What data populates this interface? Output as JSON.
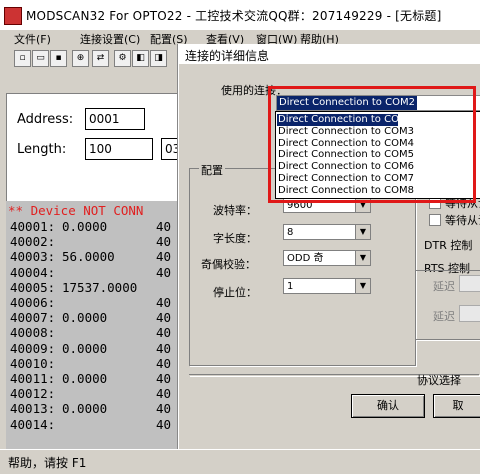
{
  "app": {
    "title": "MODSCAN32 For OPTO22 - 工控技术交流QQ群：207149229 - [无标题]",
    "menus": [
      "文件(F)",
      "连接设置(C)",
      "配置(S)",
      "查看(V)",
      "窗口(W)",
      "帮助(H)"
    ],
    "toolbar_icons": [
      "new-file-icon",
      "open-folder-icon",
      "save-icon",
      "print-icon",
      "connect-icon",
      "disconnect-icon",
      "tool-icon",
      "tool2-icon",
      "tool3-icon",
      "tool4-icon"
    ]
  },
  "form": {
    "address_label": "Address:",
    "address_value": "0001",
    "length_label": "Length:",
    "length_value": "100",
    "extra_value": "03"
  },
  "registers": {
    "error_text": "** Device NOT CONN",
    "rows": [
      {
        "addr": "40001:",
        "val": "0.0000",
        "tail": "40"
      },
      {
        "addr": "40002:",
        "val": "",
        "tail": "40"
      },
      {
        "addr": "40003:",
        "val": "56.0000",
        "tail": "40"
      },
      {
        "addr": "40004:",
        "val": "",
        "tail": "40"
      },
      {
        "addr": "40005:",
        "val": "17537.0000",
        "tail": ""
      },
      {
        "addr": "40006:",
        "val": "",
        "tail": "40"
      },
      {
        "addr": "40007:",
        "val": "0.0000",
        "tail": "40"
      },
      {
        "addr": "40008:",
        "val": "",
        "tail": "40"
      },
      {
        "addr": "40009:",
        "val": "0.0000",
        "tail": "40"
      },
      {
        "addr": "40010:",
        "val": "",
        "tail": "40"
      },
      {
        "addr": "40011:",
        "val": "0.0000",
        "tail": "40"
      },
      {
        "addr": "40012:",
        "val": "",
        "tail": "40"
      },
      {
        "addr": "40013:",
        "val": "0.0000",
        "tail": "40"
      },
      {
        "addr": "40014:",
        "val": "",
        "tail": "40"
      }
    ]
  },
  "status": {
    "text": "帮助，请按 F1"
  },
  "dialog": {
    "title": "连接的详细信息",
    "connection_label": "使用的连接：",
    "selected_connection": "Direct Connection to COM2",
    "options": [
      "Direct Connection to COM2",
      "Direct Connection to COM3",
      "Direct Connection to COM4",
      "Direct Connection to COM5",
      "Direct Connection to COM6",
      "Direct Connection to COM7",
      "Direct Connection to COM8"
    ],
    "config_group_label": "配置",
    "baud_label": "波特率：",
    "baud_value": "9600",
    "databits_label": "字长度：",
    "databits_value": "8",
    "parity_label": "奇偶校验：",
    "parity_value": "ODD 奇",
    "stopbits_label": "停止位：",
    "stopbits_value": "1",
    "wait_cts_label": "等待从设",
    "wait_dsr_label": "等待从设",
    "dtr_label": "DTR 控制",
    "rts_label": "RTS 控制",
    "delay_label_1": "延迟",
    "delay_label_2": "延迟",
    "protocol_button": "协议选择",
    "ok_button": "确认",
    "cancel_button": "取"
  },
  "colors": {
    "highlight": "#e01818",
    "selection": "#0a246a",
    "error_text": "#e02020"
  }
}
